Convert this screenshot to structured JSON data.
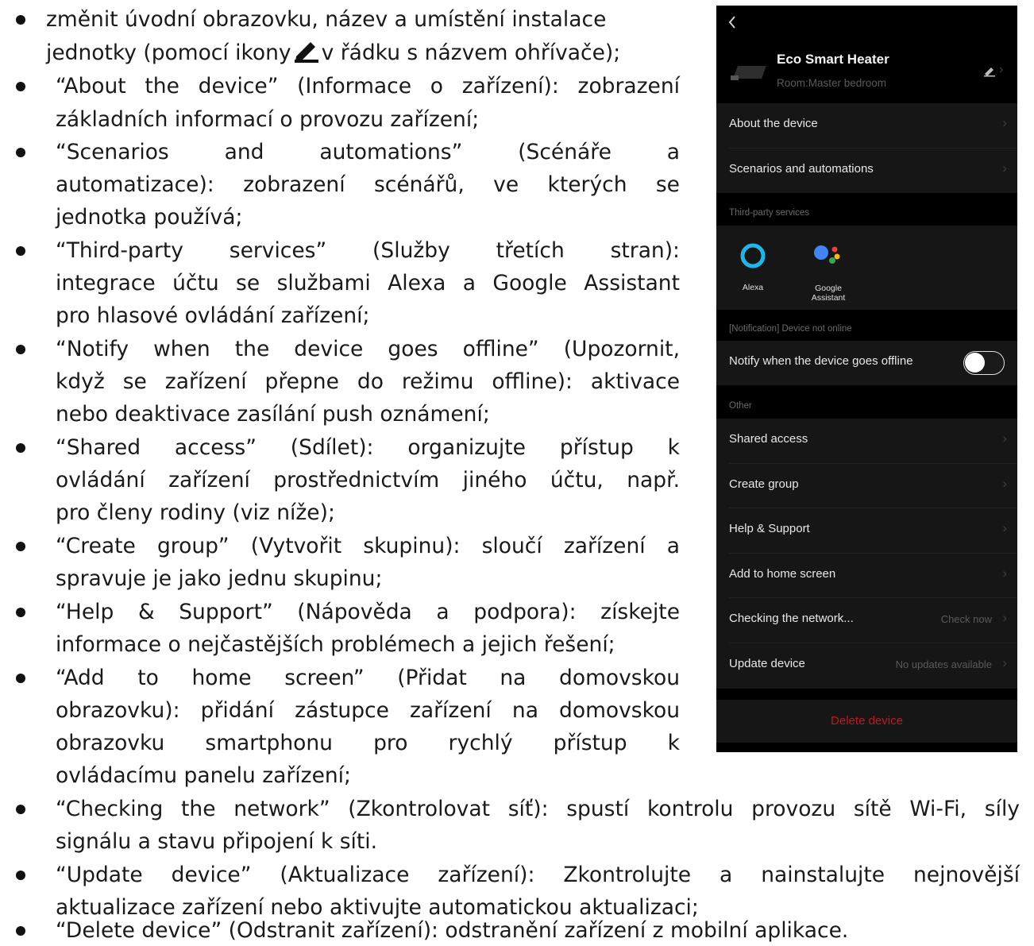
{
  "bullets": [
    {
      "lines": [
        "změnit úvodní obrazovku, název a umístění instalace",
        "jednotky (pomocí ikony",
        "v řádku s názvem ohřívače);"
      ],
      "icon": "pencil-icon"
    },
    {
      "lines": [
        "“About the device” (Informace o zařízení): zobrazení",
        "základních informací o provozu zařízení;"
      ]
    },
    {
      "lines": [
        "“Scenarios and automations” (Scénáře a",
        "automatizace): zobrazení scénářů, ve kterých se",
        "jednotka používá;"
      ]
    },
    {
      "lines": [
        "“Third-party services” (Služby třetích stran):",
        "integrace účtu se službami Alexa a Google Assistant",
        "pro hlasové ovládání zařízení;"
      ]
    },
    {
      "lines": [
        "“Notify when the device goes offline” (Upozornit,",
        "když se zařízení přepne do režimu offline): aktivace",
        "nebo deaktivace zasílání push oznámení;"
      ]
    },
    {
      "lines": [
        "“Shared access” (Sdílet): organizujte přístup k",
        "ovládání zařízení prostřednictvím jiného účtu, např.",
        "pro členy rodiny (viz níže);"
      ]
    },
    {
      "lines": [
        "“Create group” (Vytvořit skupinu): sloučí zařízení a",
        "spravuje je jako jednu skupinu;"
      ]
    },
    {
      "lines": [
        "“Help & Support” (Nápověda a podpora): získejte",
        "informace o nejčastějších problémech a jejich řešení;"
      ]
    },
    {
      "lines": [
        "“Add to home screen” (Přidat na domovskou",
        "obrazovku): přidání zástupce zařízení na domovskou",
        "obrazovku smartphonu pro rychlý přístup k",
        "ovládacímu panelu zařízení;"
      ]
    },
    {
      "lines": [
        "“Checking the network” (Zkontrolovat síť): spustí kontrolu provozu sítě Wi-Fi, síly",
        "signálu a stavu připojení k síti."
      ]
    },
    {
      "lines": [
        "“Update device” (Aktualizace zařízení): Zkontrolujte a nainstalujte nejnovější",
        "aktualizace zařízení nebo aktivujte automatickou aktualizaci;"
      ]
    },
    {
      "lines": [
        "“Delete device” (Odstranit zařízení): odstranění zařízení z mobilní aplikace."
      ]
    }
  ],
  "phone": {
    "back_icon": "back-chevron-icon",
    "device_name": "Eco Smart Heater",
    "room": "Room:Master bedroom",
    "about": "About the device",
    "scenarios": "Scenarios and automations",
    "third_party_header": "Third-party services",
    "alexa": "Alexa",
    "google_line1": "Google",
    "google_line2": "Assistant",
    "notification_header": "[Notification] Device not online",
    "notify": "Notify when the device goes offline",
    "notify_on": false,
    "other_header": "Other",
    "shared": "Shared access",
    "create_group": "Create group",
    "help": "Help & Support",
    "add_home": "Add to home screen",
    "checking": "Checking the network...",
    "check_now": "Check now",
    "update": "Update device",
    "no_updates": "No updates available",
    "delete": "Delete device",
    "colors": {
      "delete": "#c4161c",
      "alexa": "#1fb6e8",
      "google_blue": "#4285f4",
      "google_red": "#ea4335",
      "google_yellow": "#fbbc05",
      "google_green": "#34a853"
    }
  }
}
